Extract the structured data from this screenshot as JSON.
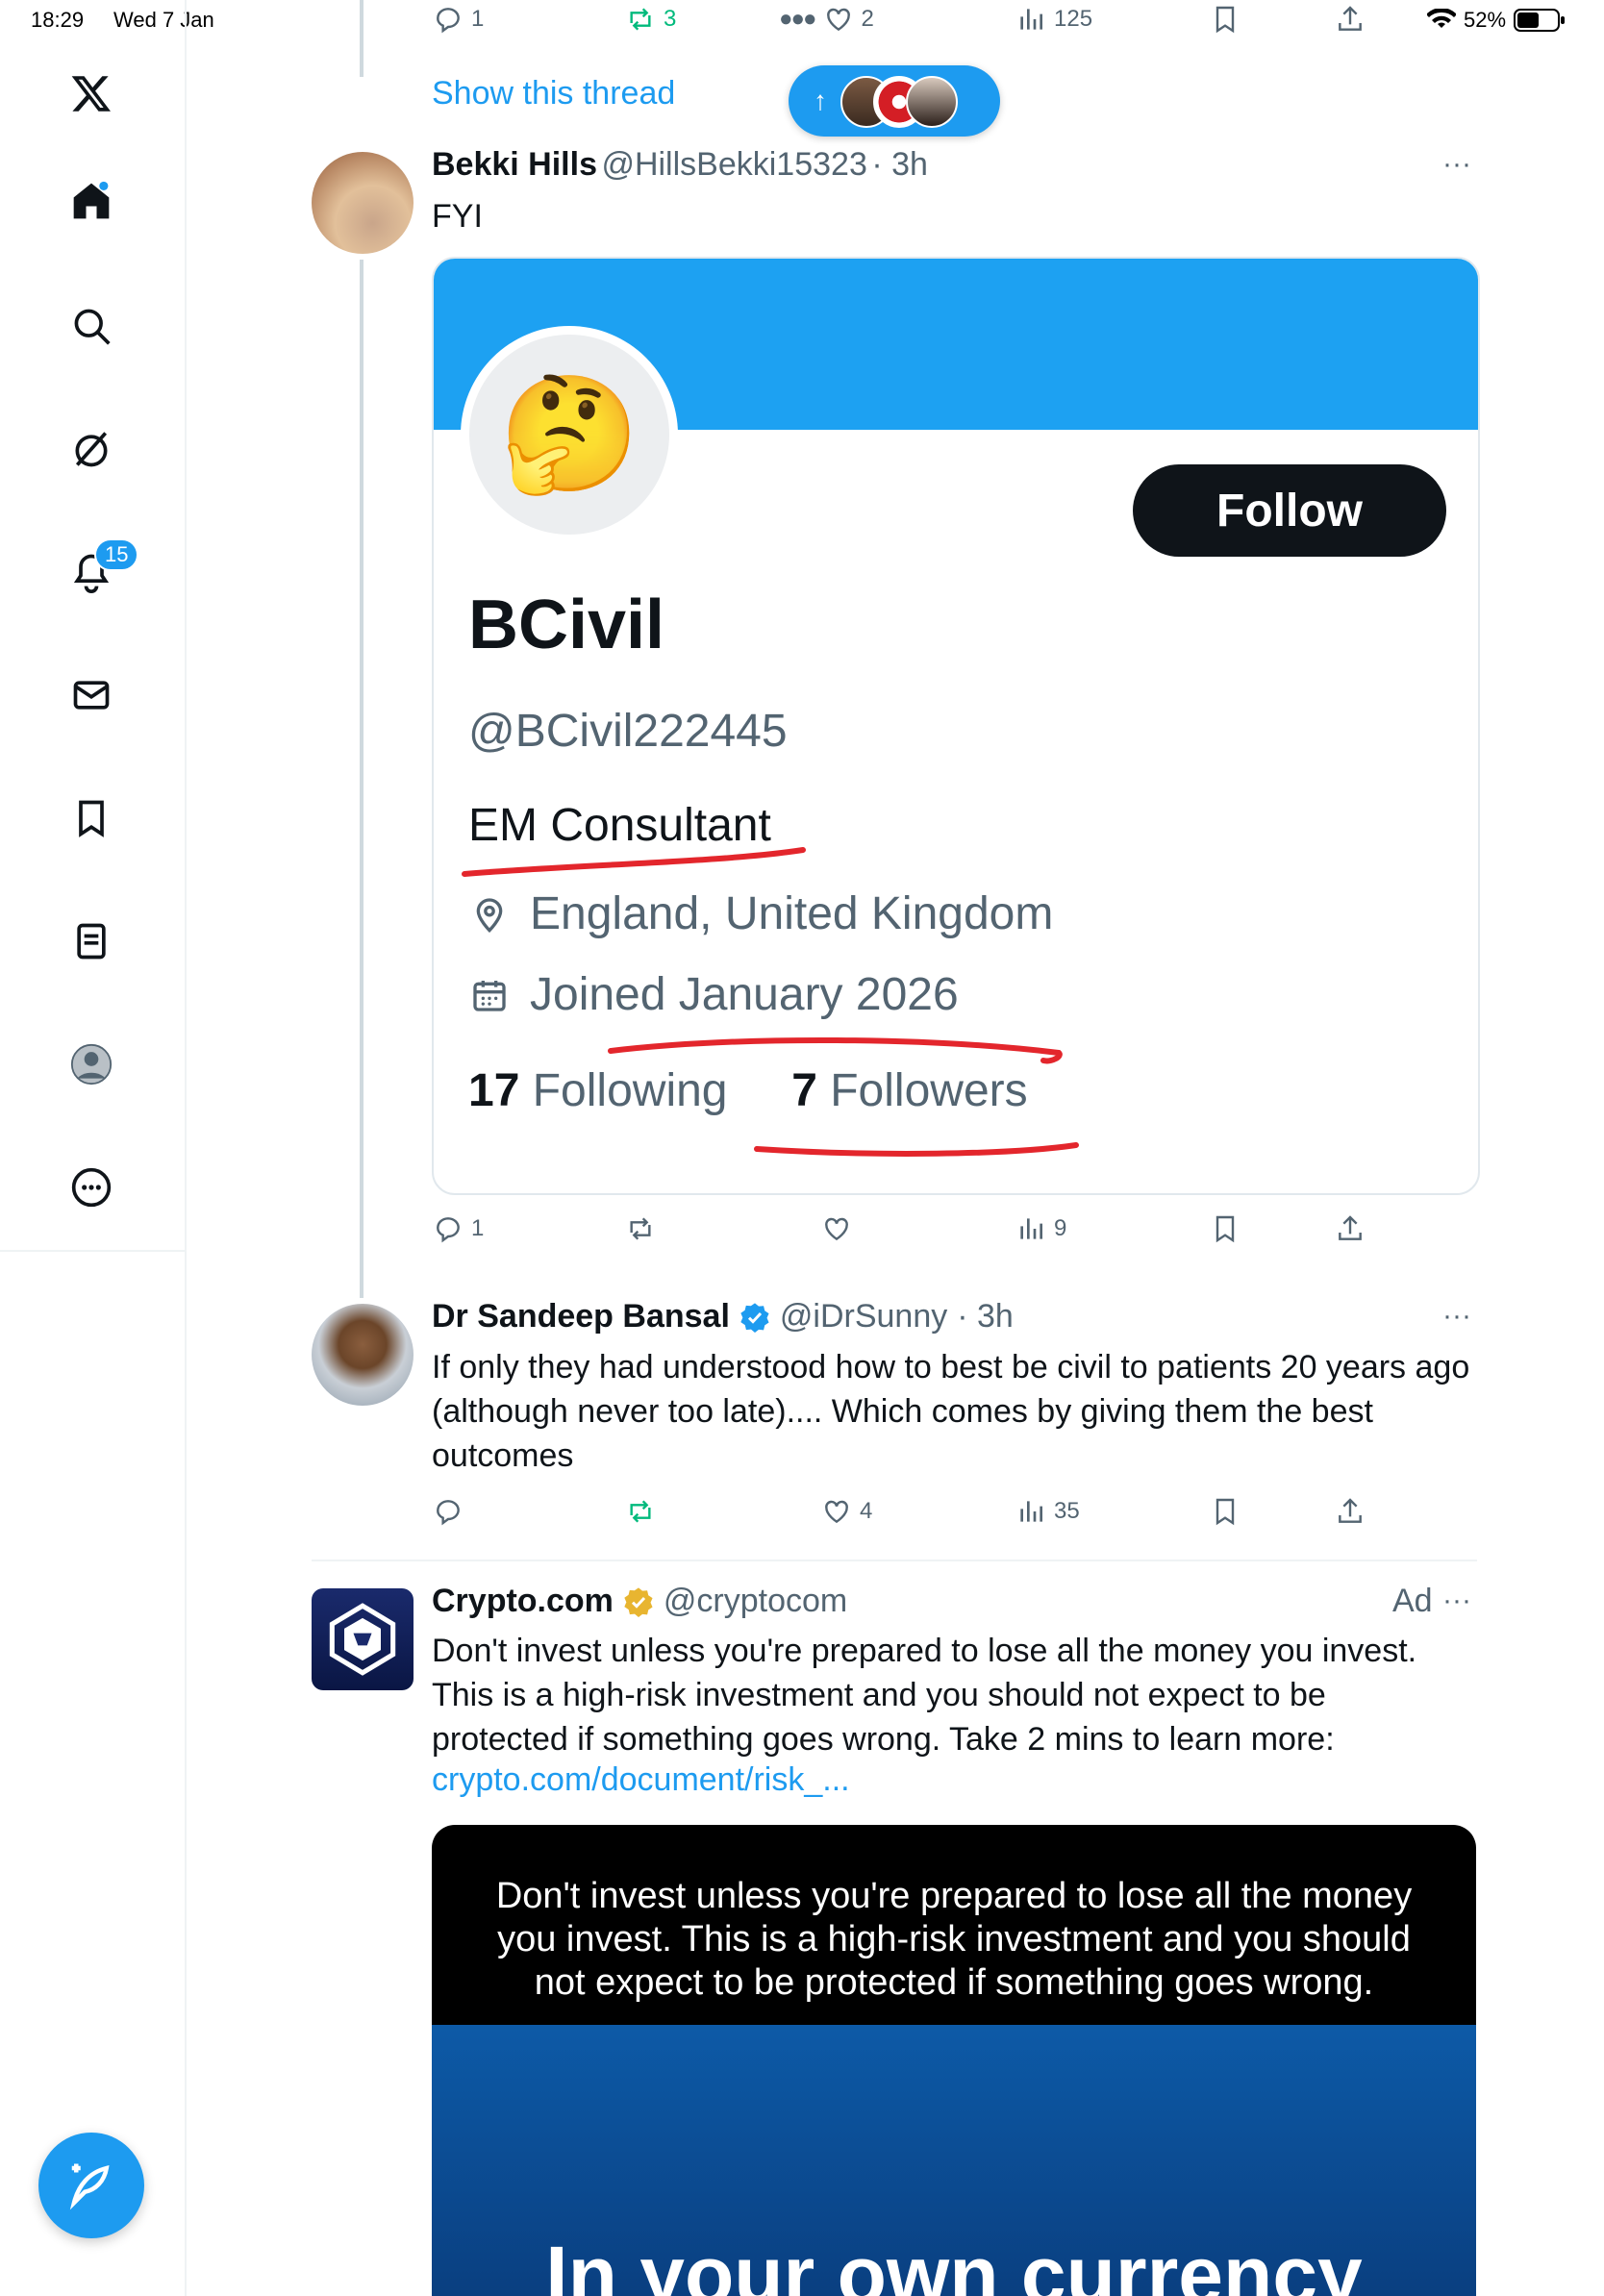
{
  "status_bar": {
    "time": "18:29",
    "date": "Wed 7 Jan",
    "battery": "52%"
  },
  "sidebar": {
    "logo": "x-logo",
    "notifications_badge": "15",
    "items": [
      "home-icon",
      "search-icon",
      "grok-icon",
      "notifications-icon",
      "messages-icon",
      "bookmarks-icon",
      "lists-icon",
      "profile-icon",
      "more-icon"
    ]
  },
  "top_actions": {
    "replies": "1",
    "reposts": "3",
    "likes": "2",
    "views": "125"
  },
  "thread": {
    "show_thread": "Show this thread"
  },
  "tweet1": {
    "name": "Bekki Hills",
    "handle": "@HillsBekki15323",
    "time": "· 3h",
    "text": "FYI",
    "profile_card": {
      "follow": "Follow",
      "display_name": "BCivil",
      "username": "@BCivil222445",
      "bio": "EM Consultant",
      "location": "England, United Kingdom",
      "joined": "Joined January 2026",
      "following_count": "17",
      "following_label": "Following",
      "followers_count": "7",
      "followers_label": "Followers",
      "emoji": "🤔"
    },
    "actions": {
      "replies": "1",
      "reposts": "",
      "likes": "",
      "views": "9"
    }
  },
  "tweet2": {
    "name": "Dr Sandeep Bansal",
    "handle": "@iDrSunny",
    "time": "· 3h",
    "text": "If only they had understood how to best be civil to patients 20 years ago (although never too late).... Which comes by giving them the best outcomes",
    "actions": {
      "replies": "",
      "reposts": "",
      "likes": "4",
      "views": "35"
    }
  },
  "ad": {
    "name": "Crypto.com",
    "handle": "@cryptocom",
    "label": "Ad",
    "text": "Don't invest unless you're prepared to lose all the money you invest. This is a high-risk investment and you should not expect to be protected if something goes wrong. Take 2 mins to learn more:",
    "link": "crypto.com/document/risk_...",
    "image_warning": "Don't invest unless you're prepared to lose all the money you invest. This is a high-risk investment and you should not expect to be protected if something goes wrong.",
    "image_headline": "In your own currency"
  },
  "colors": {
    "accent": "#1d9bf0",
    "repost": "#00ba7c",
    "annotation_red": "#e3262c"
  }
}
